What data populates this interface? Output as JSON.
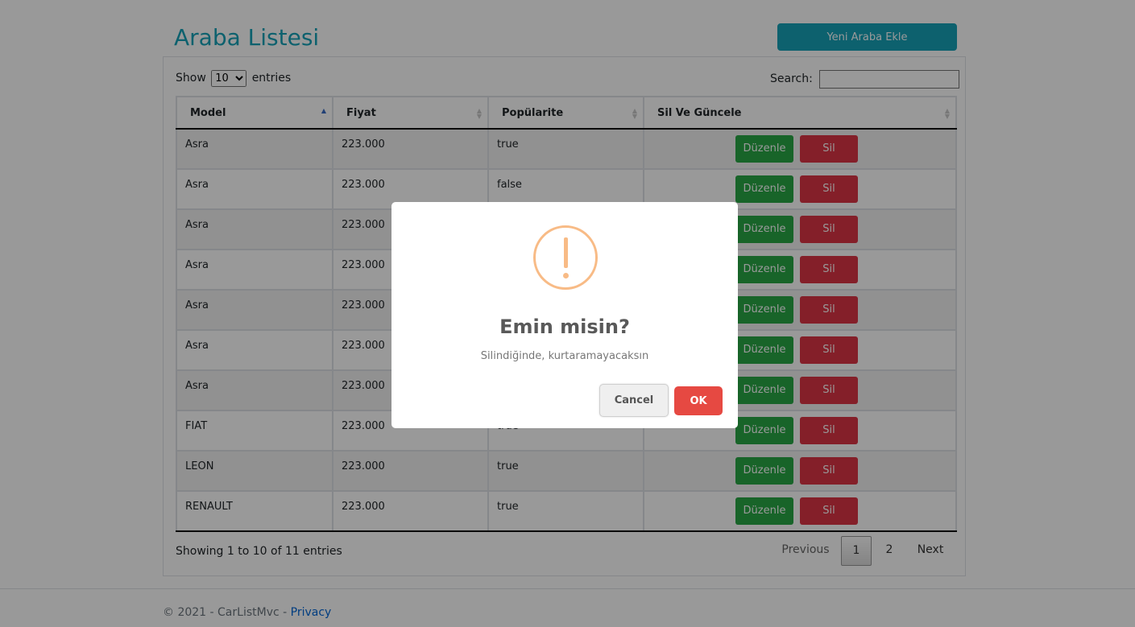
{
  "header": {
    "title": "Araba Listesi",
    "add_button": "Yeni Araba Ekle"
  },
  "controls": {
    "show_label": "Show",
    "entries_label": "entries",
    "page_size": "10",
    "search_label": "Search:",
    "search_value": ""
  },
  "table": {
    "columns": [
      "Model",
      "Fiyat",
      "Popülarite",
      "Sil Ve Güncele"
    ],
    "sorted_column": "Model",
    "rows": [
      {
        "model": "Asra",
        "price": "223.000",
        "popular": "true"
      },
      {
        "model": "Asra",
        "price": "223.000",
        "popular": "false"
      },
      {
        "model": "Asra",
        "price": "223.000",
        "popular": ""
      },
      {
        "model": "Asra",
        "price": "223.000",
        "popular": ""
      },
      {
        "model": "Asra",
        "price": "223.000",
        "popular": ""
      },
      {
        "model": "Asra",
        "price": "223.000",
        "popular": ""
      },
      {
        "model": "Asra",
        "price": "223.000",
        "popular": ""
      },
      {
        "model": "FIAT",
        "price": "223.000",
        "popular": "true"
      },
      {
        "model": "LEON",
        "price": "223.000",
        "popular": "true"
      },
      {
        "model": "RENAULT",
        "price": "223.000",
        "popular": "true"
      }
    ],
    "edit_label": "Düzenle",
    "delete_label": "Sil"
  },
  "footer_info": {
    "summary": "Showing 1 to 10 of 11 entries",
    "previous": "Previous",
    "pages": [
      "1",
      "2"
    ],
    "current_page": "1",
    "next": "Next"
  },
  "site_footer": {
    "copyright": "© 2021 - CarListMvc - ",
    "privacy": "Privacy"
  },
  "dialog": {
    "title": "Emin misin?",
    "text": "Silindiğinde, kurtaramayacaksın",
    "cancel": "Cancel",
    "ok": "OK"
  },
  "colors": {
    "accent": "#17a2b8",
    "edit": "#28a745",
    "delete": "#dc3545",
    "warning_icon": "#f8bb86",
    "confirm": "#e64942"
  },
  "icons": {
    "dialog_icon": "warning-icon",
    "sort_icon": "sort-arrows-icon"
  }
}
